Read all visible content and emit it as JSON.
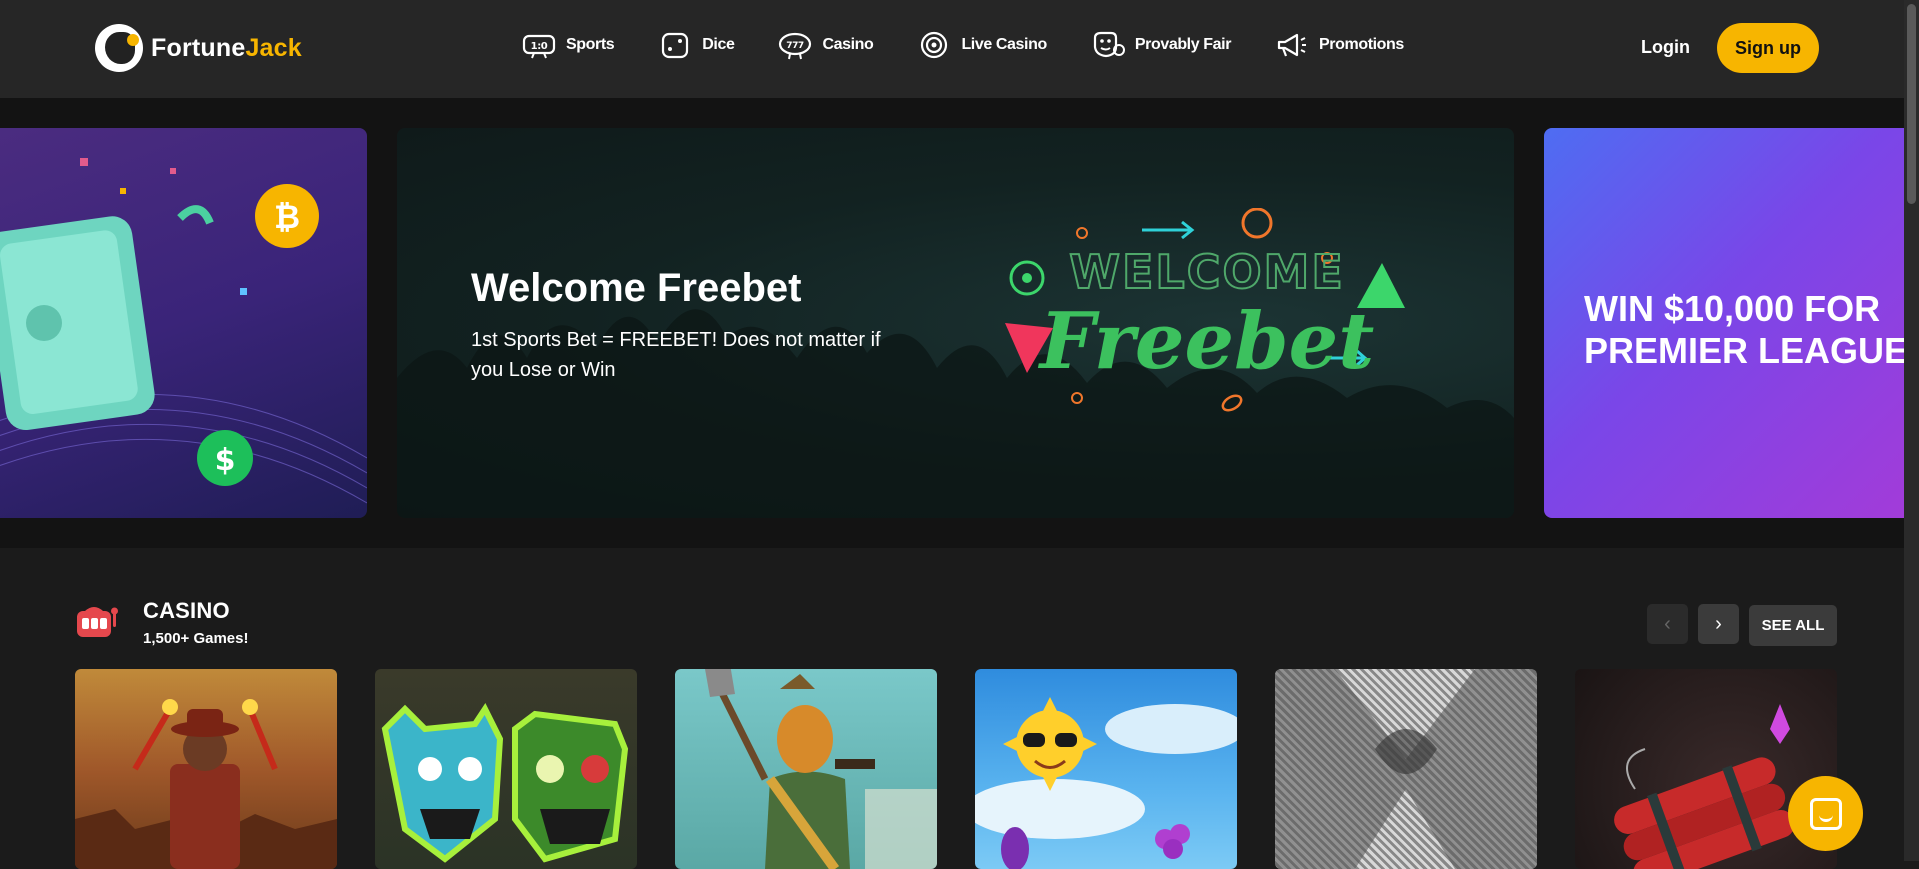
{
  "header": {
    "logo_part1": "Fortune",
    "logo_part2": "Jack",
    "nav": [
      {
        "label": "Sports",
        "icon": "scoreboard-icon"
      },
      {
        "label": "Dice",
        "icon": "dice-icon"
      },
      {
        "label": "Casino",
        "icon": "slot-machine-icon"
      },
      {
        "label": "Live Casino",
        "icon": "target-icon"
      },
      {
        "label": "Provably Fair",
        "icon": "provably-fair-icon"
      },
      {
        "label": "Promotions",
        "icon": "megaphone-icon"
      }
    ],
    "login_label": "Login",
    "signup_label": "Sign up"
  },
  "banner": {
    "main_title": "Welcome Freebet",
    "main_desc": "1st Sports Bet = FREEBET! Does not matter if you Lose or Win",
    "art_line1": "WELCOME",
    "art_line2": "Freebet",
    "right_title": "WIN $10,000 FOR PREMIER LEAGUE",
    "active_dot": 0,
    "dot_count": 4
  },
  "casino": {
    "title": "CASINO",
    "subtitle": "1,500+ Games!",
    "see_all_label": "SEE ALL",
    "prev_label": "‹",
    "next_label": "›"
  },
  "colors": {
    "accent": "#f7b500",
    "header_bg": "#262626",
    "page_bg": "#1b1b1b"
  }
}
